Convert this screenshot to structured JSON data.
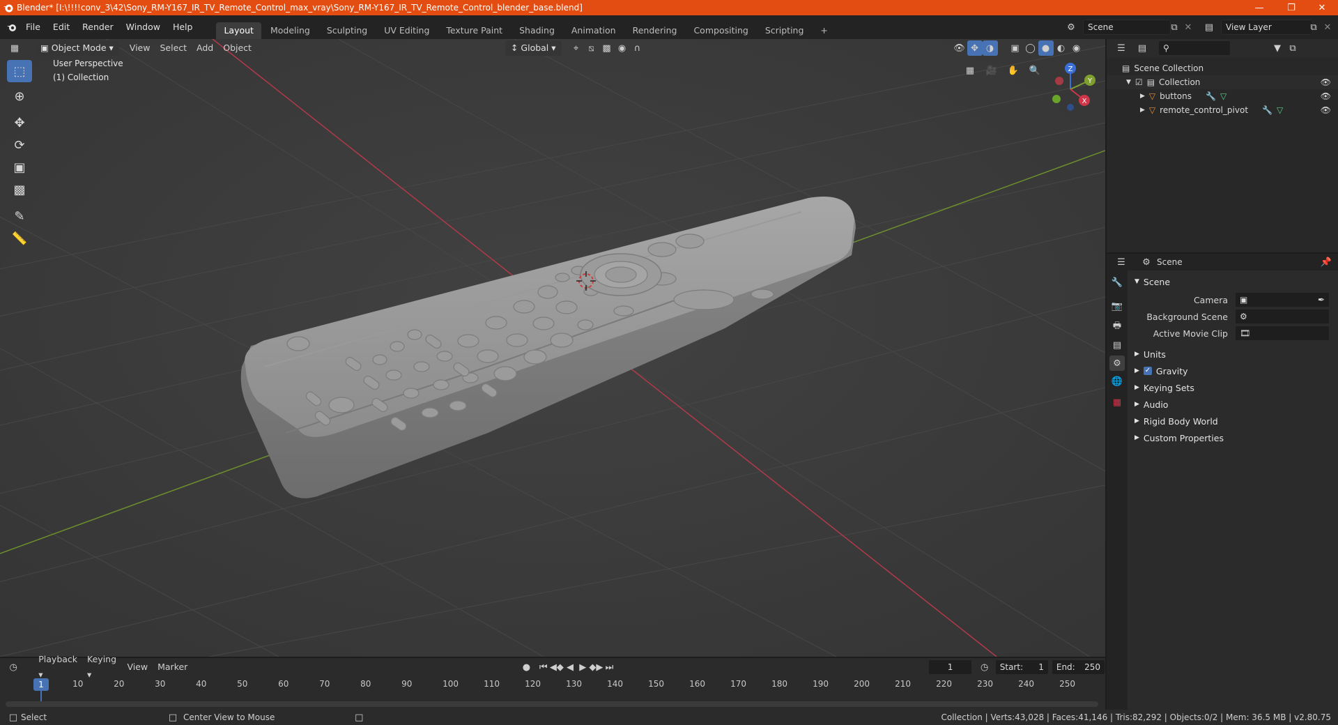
{
  "window": {
    "title": "Blender* [I:\\!!!!conv_3\\42\\Sony_RM-Y167_IR_TV_Remote_Control_max_vray\\Sony_RM-Y167_IR_TV_Remote_Control_blender_base.blend]"
  },
  "menu": [
    "File",
    "Edit",
    "Render",
    "Window",
    "Help"
  ],
  "workspaces": [
    "Layout",
    "Modeling",
    "Sculpting",
    "UV Editing",
    "Texture Paint",
    "Shading",
    "Animation",
    "Rendering",
    "Compositing",
    "Scripting"
  ],
  "scene_field": "Scene",
  "view_layer_field": "View Layer",
  "viewport": {
    "mode": "Object Mode",
    "menus": [
      "View",
      "Select",
      "Add",
      "Object"
    ],
    "transform": "Global",
    "overlay_title": "User Perspective",
    "overlay_collection": "(1) Collection",
    "gizmo": {
      "x": "X",
      "y": "Y",
      "z": "Z"
    }
  },
  "outliner": {
    "root": "Scene Collection",
    "collection": "Collection",
    "objects": [
      "buttons",
      "remote_control_pivot"
    ]
  },
  "properties": {
    "header": "Scene",
    "section": "Scene",
    "camera_label": "Camera",
    "background_scene_label": "Background Scene",
    "movie_clip_label": "Active Movie Clip",
    "panels": [
      "Units",
      "Gravity",
      "Keying Sets",
      "Audio",
      "Rigid Body World",
      "Custom Properties"
    ]
  },
  "timeline": {
    "menus": [
      "Playback",
      "Keying",
      "View",
      "Marker"
    ],
    "current_frame": "1",
    "start_label": "Start:",
    "start": "1",
    "end_label": "End:",
    "end": "250",
    "ticks": [
      "10",
      "20",
      "30",
      "40",
      "50",
      "60",
      "70",
      "80",
      "90",
      "100",
      "110",
      "120",
      "130",
      "140",
      "150",
      "160",
      "170",
      "180",
      "190",
      "200",
      "210",
      "220",
      "230",
      "240",
      "250"
    ],
    "playhead": "1"
  },
  "status": {
    "left": "Select",
    "middle": "Center View to Mouse",
    "right": "Collection | Verts:43,028 | Faces:41,146 | Tris:82,292 | Objects:0/2 | Mem: 36.5 MB | v2.80.75"
  },
  "colors": {
    "title_bar": "#e44d12",
    "accent": "#4772b3",
    "x_axis": "#d0354a",
    "y_axis": "#7fa02f",
    "z_axis": "#3a6fd8"
  }
}
